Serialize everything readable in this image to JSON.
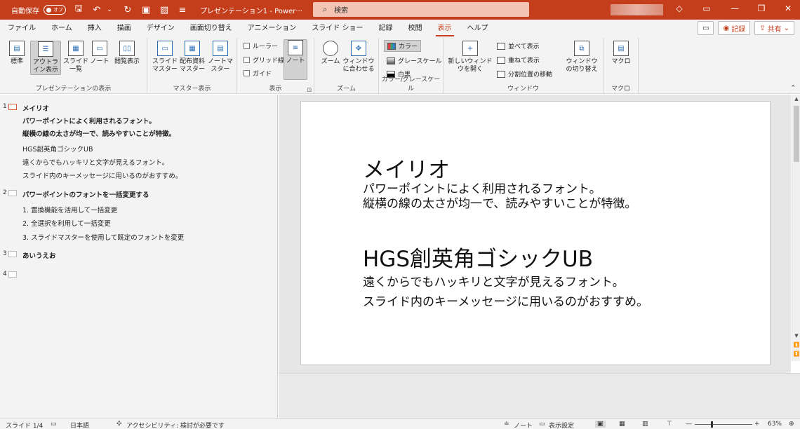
{
  "titlebar": {
    "autosave_label": "自動保存",
    "autosave_state": "オフ",
    "title": "プレゼンテーション1 - Power···",
    "search_placeholder": "検索"
  },
  "menu": {
    "tabs": [
      "ファイル",
      "ホーム",
      "挿入",
      "描画",
      "デザイン",
      "画面切り替え",
      "アニメーション",
      "スライド ショー",
      "記録",
      "校閲",
      "表示",
      "ヘルプ"
    ],
    "active_tab": "表示",
    "record_label": "記録",
    "share_label": "共有"
  },
  "ribbon": {
    "pres_view": {
      "label": "プレゼンテーションの表示",
      "normal": "標準",
      "outline": "アウトライン表示",
      "sorter": "スライド一覧",
      "notes": "ノート",
      "reading": "閲覧表示"
    },
    "master_view": {
      "label": "マスター表示",
      "slide_master": "スライドマスター",
      "handout_master": "配布資料マスター",
      "notes_master": "ノートマスター"
    },
    "show": {
      "label": "表示",
      "ruler": "ルーラー",
      "grid": "グリッド線",
      "guides": "ガイド",
      "notes": "ノート"
    },
    "zoom": {
      "label": "ズーム",
      "zoom": "ズーム",
      "fit": "ウィンドウに合わせる"
    },
    "color": {
      "label": "カラー/グレースケール",
      "color": "カラー",
      "grayscale": "グレースケール",
      "bw": "白黒"
    },
    "window": {
      "label": "ウィンドウ",
      "new_window": "新しいウィンドウを開く",
      "arrange": "並べて表示",
      "cascade": "重ねて表示",
      "move_split": "分割位置の移動",
      "switch": "ウィンドウの切り替え"
    },
    "macro": {
      "label": "マクロ",
      "macro": "マクロ"
    }
  },
  "outline": {
    "slides": [
      {
        "num": "1",
        "title": "メイリオ",
        "lines": [
          {
            "text": "パワーポイントによく利用されるフォント。",
            "bold": true
          },
          {
            "text": "縦横の線の太さが均一で、読みやすいことが特徴。",
            "bold": true
          },
          {
            "text": "HGS創英角ゴシックUB",
            "bold": false
          },
          {
            "text": "遠くからでもハッキリと文字が見えるフォント。",
            "bold": false
          },
          {
            "text": "スライド内のキーメッセージに用いるのがおすすめ。",
            "bold": false
          }
        ]
      },
      {
        "num": "2",
        "title": "パワーポイントのフォントを一括変更する",
        "lines": [
          {
            "text": "1. 置換機能を活用して一括変更",
            "bold": false
          },
          {
            "text": "2. 全選択を利用して一括変更",
            "bold": false
          },
          {
            "text": "3. スライドマスターを使用して既定のフォントを変更",
            "bold": false
          }
        ]
      },
      {
        "num": "3",
        "title": "あいうえお",
        "lines": []
      },
      {
        "num": "4",
        "title": "",
        "lines": []
      }
    ]
  },
  "slide": {
    "heading1": "メイリオ",
    "para1_line1": "パワーポイントによく利用されるフォント。",
    "para1_line2": "縦横の線の太さが均一で、読みやすいことが特徴。",
    "heading2": "HGS創英角ゴシックUB",
    "para2_line1": "遠くからでもハッキリと文字が見えるフォント。",
    "para2_line2": "スライド内のキーメッセージに用いるのがおすすめ。"
  },
  "statusbar": {
    "slide_info": "スライド 1/4",
    "language": "日本語",
    "accessibility": "アクセシビリティ: 検討が必要です",
    "notes": "ノート",
    "display_settings": "表示設定",
    "zoom": "63%"
  }
}
